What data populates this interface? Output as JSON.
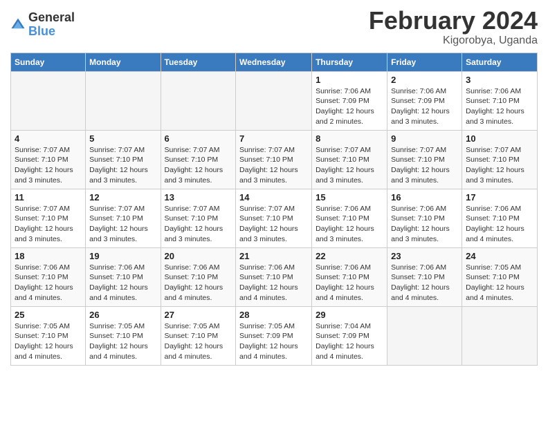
{
  "header": {
    "logo_general": "General",
    "logo_blue": "Blue",
    "title": "February 2024",
    "location": "Kigorobya, Uganda"
  },
  "days_of_week": [
    "Sunday",
    "Monday",
    "Tuesday",
    "Wednesday",
    "Thursday",
    "Friday",
    "Saturday"
  ],
  "weeks": [
    [
      {
        "num": "",
        "info": ""
      },
      {
        "num": "",
        "info": ""
      },
      {
        "num": "",
        "info": ""
      },
      {
        "num": "",
        "info": ""
      },
      {
        "num": "1",
        "info": "Sunrise: 7:06 AM\nSunset: 7:09 PM\nDaylight: 12 hours\nand 2 minutes."
      },
      {
        "num": "2",
        "info": "Sunrise: 7:06 AM\nSunset: 7:09 PM\nDaylight: 12 hours\nand 3 minutes."
      },
      {
        "num": "3",
        "info": "Sunrise: 7:06 AM\nSunset: 7:10 PM\nDaylight: 12 hours\nand 3 minutes."
      }
    ],
    [
      {
        "num": "4",
        "info": "Sunrise: 7:07 AM\nSunset: 7:10 PM\nDaylight: 12 hours\nand 3 minutes."
      },
      {
        "num": "5",
        "info": "Sunrise: 7:07 AM\nSunset: 7:10 PM\nDaylight: 12 hours\nand 3 minutes."
      },
      {
        "num": "6",
        "info": "Sunrise: 7:07 AM\nSunset: 7:10 PM\nDaylight: 12 hours\nand 3 minutes."
      },
      {
        "num": "7",
        "info": "Sunrise: 7:07 AM\nSunset: 7:10 PM\nDaylight: 12 hours\nand 3 minutes."
      },
      {
        "num": "8",
        "info": "Sunrise: 7:07 AM\nSunset: 7:10 PM\nDaylight: 12 hours\nand 3 minutes."
      },
      {
        "num": "9",
        "info": "Sunrise: 7:07 AM\nSunset: 7:10 PM\nDaylight: 12 hours\nand 3 minutes."
      },
      {
        "num": "10",
        "info": "Sunrise: 7:07 AM\nSunset: 7:10 PM\nDaylight: 12 hours\nand 3 minutes."
      }
    ],
    [
      {
        "num": "11",
        "info": "Sunrise: 7:07 AM\nSunset: 7:10 PM\nDaylight: 12 hours\nand 3 minutes."
      },
      {
        "num": "12",
        "info": "Sunrise: 7:07 AM\nSunset: 7:10 PM\nDaylight: 12 hours\nand 3 minutes."
      },
      {
        "num": "13",
        "info": "Sunrise: 7:07 AM\nSunset: 7:10 PM\nDaylight: 12 hours\nand 3 minutes."
      },
      {
        "num": "14",
        "info": "Sunrise: 7:07 AM\nSunset: 7:10 PM\nDaylight: 12 hours\nand 3 minutes."
      },
      {
        "num": "15",
        "info": "Sunrise: 7:06 AM\nSunset: 7:10 PM\nDaylight: 12 hours\nand 3 minutes."
      },
      {
        "num": "16",
        "info": "Sunrise: 7:06 AM\nSunset: 7:10 PM\nDaylight: 12 hours\nand 3 minutes."
      },
      {
        "num": "17",
        "info": "Sunrise: 7:06 AM\nSunset: 7:10 PM\nDaylight: 12 hours\nand 4 minutes."
      }
    ],
    [
      {
        "num": "18",
        "info": "Sunrise: 7:06 AM\nSunset: 7:10 PM\nDaylight: 12 hours\nand 4 minutes."
      },
      {
        "num": "19",
        "info": "Sunrise: 7:06 AM\nSunset: 7:10 PM\nDaylight: 12 hours\nand 4 minutes."
      },
      {
        "num": "20",
        "info": "Sunrise: 7:06 AM\nSunset: 7:10 PM\nDaylight: 12 hours\nand 4 minutes."
      },
      {
        "num": "21",
        "info": "Sunrise: 7:06 AM\nSunset: 7:10 PM\nDaylight: 12 hours\nand 4 minutes."
      },
      {
        "num": "22",
        "info": "Sunrise: 7:06 AM\nSunset: 7:10 PM\nDaylight: 12 hours\nand 4 minutes."
      },
      {
        "num": "23",
        "info": "Sunrise: 7:06 AM\nSunset: 7:10 PM\nDaylight: 12 hours\nand 4 minutes."
      },
      {
        "num": "24",
        "info": "Sunrise: 7:05 AM\nSunset: 7:10 PM\nDaylight: 12 hours\nand 4 minutes."
      }
    ],
    [
      {
        "num": "25",
        "info": "Sunrise: 7:05 AM\nSunset: 7:10 PM\nDaylight: 12 hours\nand 4 minutes."
      },
      {
        "num": "26",
        "info": "Sunrise: 7:05 AM\nSunset: 7:10 PM\nDaylight: 12 hours\nand 4 minutes."
      },
      {
        "num": "27",
        "info": "Sunrise: 7:05 AM\nSunset: 7:10 PM\nDaylight: 12 hours\nand 4 minutes."
      },
      {
        "num": "28",
        "info": "Sunrise: 7:05 AM\nSunset: 7:09 PM\nDaylight: 12 hours\nand 4 minutes."
      },
      {
        "num": "29",
        "info": "Sunrise: 7:04 AM\nSunset: 7:09 PM\nDaylight: 12 hours\nand 4 minutes."
      },
      {
        "num": "",
        "info": ""
      },
      {
        "num": "",
        "info": ""
      }
    ]
  ]
}
